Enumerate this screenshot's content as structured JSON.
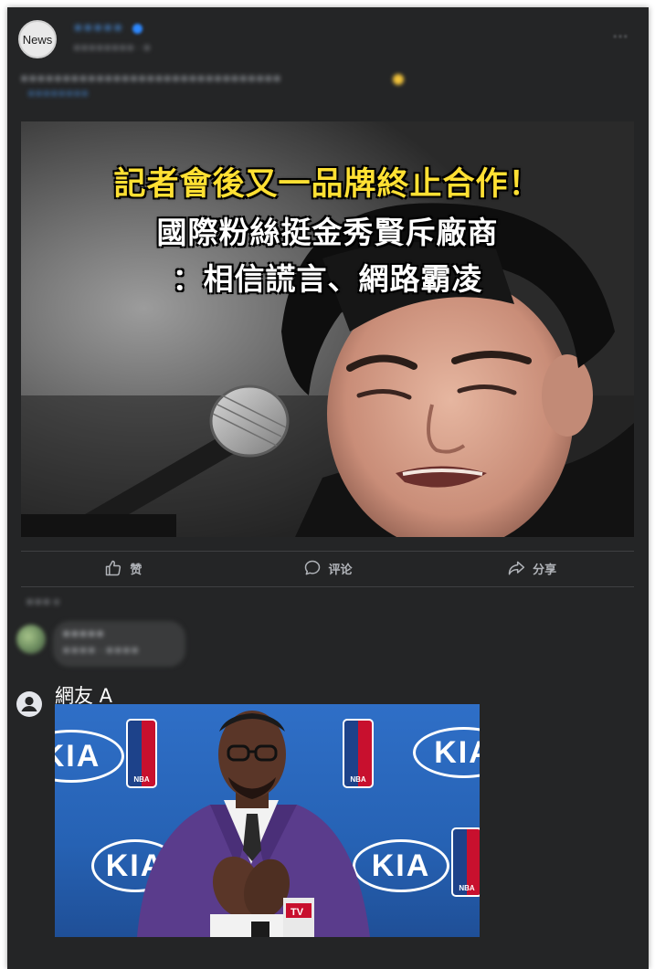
{
  "header": {
    "avatar_label": "News",
    "page_name": "⚫⚫⚫⚫⚫",
    "post_meta": "⚫⚫⚫⚫⚫⚫⚫⚫ · ⚫",
    "caption_line1": "⚫⚫⚫⚫⚫⚫⚫⚫⚫⚫⚫⚫⚫⚫⚫⚫⚫⚫⚫⚫⚫⚫⚫⚫⚫⚫⚫⚫⚫⚫⚫",
    "caption_line2": "⚫⚫⚫⚫⚫⚫⚫⚫",
    "more_label": "···"
  },
  "main_photo": {
    "banner_line1": "記者會後又一品牌終止合作！",
    "banner_line2": "國際粉絲挺金秀賢斥廠商",
    "banner_line3": "：相信謊言、網路霸凌"
  },
  "actions": {
    "like_label": "赞",
    "comment_label": "评论",
    "share_label": "分享"
  },
  "comments": {
    "sort_label": "⚫⚫⚫ ▾",
    "blurred_name": "⚫⚫⚫⚫⚫",
    "blurred_text": "⚫⚫⚫⚫ · ⚫⚫⚫⚫"
  },
  "reply": {
    "author": "網友 A"
  },
  "reply_photo": {
    "sponsor_text": "KIA",
    "league_text": "NBA",
    "mic_text": "TV"
  },
  "colors": {
    "card_bg": "#242526",
    "link_blue": "#4a90e2",
    "banner_yellow": "#ffe033",
    "action_gray": "#b0b3b8",
    "court_blue": "#2662b4"
  }
}
